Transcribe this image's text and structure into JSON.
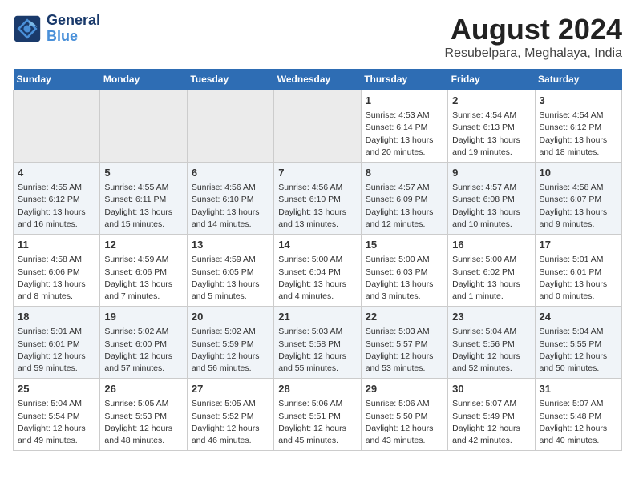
{
  "logo": {
    "line1": "General",
    "line2": "Blue"
  },
  "title": "August 2024",
  "subtitle": "Resubelpara, Meghalaya, India",
  "weekdays": [
    "Sunday",
    "Monday",
    "Tuesday",
    "Wednesday",
    "Thursday",
    "Friday",
    "Saturday"
  ],
  "weeks": [
    [
      {
        "day": "",
        "info": ""
      },
      {
        "day": "",
        "info": ""
      },
      {
        "day": "",
        "info": ""
      },
      {
        "day": "",
        "info": ""
      },
      {
        "day": "1",
        "info": "Sunrise: 4:53 AM\nSunset: 6:14 PM\nDaylight: 13 hours\nand 20 minutes."
      },
      {
        "day": "2",
        "info": "Sunrise: 4:54 AM\nSunset: 6:13 PM\nDaylight: 13 hours\nand 19 minutes."
      },
      {
        "day": "3",
        "info": "Sunrise: 4:54 AM\nSunset: 6:12 PM\nDaylight: 13 hours\nand 18 minutes."
      }
    ],
    [
      {
        "day": "4",
        "info": "Sunrise: 4:55 AM\nSunset: 6:12 PM\nDaylight: 13 hours\nand 16 minutes."
      },
      {
        "day": "5",
        "info": "Sunrise: 4:55 AM\nSunset: 6:11 PM\nDaylight: 13 hours\nand 15 minutes."
      },
      {
        "day": "6",
        "info": "Sunrise: 4:56 AM\nSunset: 6:10 PM\nDaylight: 13 hours\nand 14 minutes."
      },
      {
        "day": "7",
        "info": "Sunrise: 4:56 AM\nSunset: 6:10 PM\nDaylight: 13 hours\nand 13 minutes."
      },
      {
        "day": "8",
        "info": "Sunrise: 4:57 AM\nSunset: 6:09 PM\nDaylight: 13 hours\nand 12 minutes."
      },
      {
        "day": "9",
        "info": "Sunrise: 4:57 AM\nSunset: 6:08 PM\nDaylight: 13 hours\nand 10 minutes."
      },
      {
        "day": "10",
        "info": "Sunrise: 4:58 AM\nSunset: 6:07 PM\nDaylight: 13 hours\nand 9 minutes."
      }
    ],
    [
      {
        "day": "11",
        "info": "Sunrise: 4:58 AM\nSunset: 6:06 PM\nDaylight: 13 hours\nand 8 minutes."
      },
      {
        "day": "12",
        "info": "Sunrise: 4:59 AM\nSunset: 6:06 PM\nDaylight: 13 hours\nand 7 minutes."
      },
      {
        "day": "13",
        "info": "Sunrise: 4:59 AM\nSunset: 6:05 PM\nDaylight: 13 hours\nand 5 minutes."
      },
      {
        "day": "14",
        "info": "Sunrise: 5:00 AM\nSunset: 6:04 PM\nDaylight: 13 hours\nand 4 minutes."
      },
      {
        "day": "15",
        "info": "Sunrise: 5:00 AM\nSunset: 6:03 PM\nDaylight: 13 hours\nand 3 minutes."
      },
      {
        "day": "16",
        "info": "Sunrise: 5:00 AM\nSunset: 6:02 PM\nDaylight: 13 hours\nand 1 minute."
      },
      {
        "day": "17",
        "info": "Sunrise: 5:01 AM\nSunset: 6:01 PM\nDaylight: 13 hours\nand 0 minutes."
      }
    ],
    [
      {
        "day": "18",
        "info": "Sunrise: 5:01 AM\nSunset: 6:01 PM\nDaylight: 12 hours\nand 59 minutes."
      },
      {
        "day": "19",
        "info": "Sunrise: 5:02 AM\nSunset: 6:00 PM\nDaylight: 12 hours\nand 57 minutes."
      },
      {
        "day": "20",
        "info": "Sunrise: 5:02 AM\nSunset: 5:59 PM\nDaylight: 12 hours\nand 56 minutes."
      },
      {
        "day": "21",
        "info": "Sunrise: 5:03 AM\nSunset: 5:58 PM\nDaylight: 12 hours\nand 55 minutes."
      },
      {
        "day": "22",
        "info": "Sunrise: 5:03 AM\nSunset: 5:57 PM\nDaylight: 12 hours\nand 53 minutes."
      },
      {
        "day": "23",
        "info": "Sunrise: 5:04 AM\nSunset: 5:56 PM\nDaylight: 12 hours\nand 52 minutes."
      },
      {
        "day": "24",
        "info": "Sunrise: 5:04 AM\nSunset: 5:55 PM\nDaylight: 12 hours\nand 50 minutes."
      }
    ],
    [
      {
        "day": "25",
        "info": "Sunrise: 5:04 AM\nSunset: 5:54 PM\nDaylight: 12 hours\nand 49 minutes."
      },
      {
        "day": "26",
        "info": "Sunrise: 5:05 AM\nSunset: 5:53 PM\nDaylight: 12 hours\nand 48 minutes."
      },
      {
        "day": "27",
        "info": "Sunrise: 5:05 AM\nSunset: 5:52 PM\nDaylight: 12 hours\nand 46 minutes."
      },
      {
        "day": "28",
        "info": "Sunrise: 5:06 AM\nSunset: 5:51 PM\nDaylight: 12 hours\nand 45 minutes."
      },
      {
        "day": "29",
        "info": "Sunrise: 5:06 AM\nSunset: 5:50 PM\nDaylight: 12 hours\nand 43 minutes."
      },
      {
        "day": "30",
        "info": "Sunrise: 5:07 AM\nSunset: 5:49 PM\nDaylight: 12 hours\nand 42 minutes."
      },
      {
        "day": "31",
        "info": "Sunrise: 5:07 AM\nSunset: 5:48 PM\nDaylight: 12 hours\nand 40 minutes."
      }
    ]
  ]
}
